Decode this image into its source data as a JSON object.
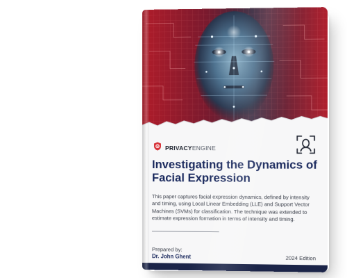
{
  "brand": {
    "name_part1": "PRIVACY",
    "name_part2": "ENGINE",
    "logo_icon": "shield-logo-icon",
    "accent_color": "#d8353b"
  },
  "cover": {
    "image_description_icon": "face-scan-image",
    "corner_icon": "face-scan-icon"
  },
  "document": {
    "title": "Investigating the Dynamics of Facial Expression",
    "description": "This paper captures facial expression dynamics, defined by intensity and timing, using Local Linear Embedding (LLE) and Support Vector Machines (SVMs) for classification. The technique was extended to estimate expression formation in terms of intensity and timing.",
    "prepared_label": "Prepared by:",
    "author": "Dr. John Ghent",
    "edition": "2024 Edition",
    "title_color": "#1b2a5e",
    "bar_color": "#1b2448"
  }
}
